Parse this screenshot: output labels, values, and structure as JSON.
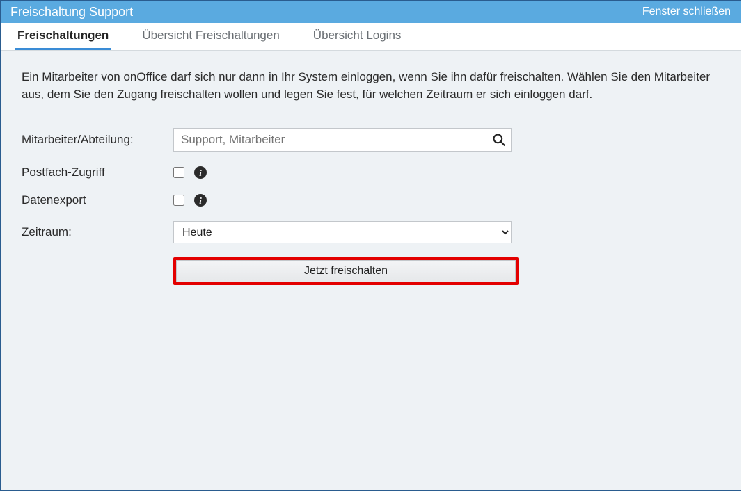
{
  "titlebar": {
    "title": "Freischaltung Support",
    "close_label": "Fenster schließen"
  },
  "tabs": [
    {
      "label": "Freischaltungen",
      "active": true
    },
    {
      "label": "Übersicht Freischaltungen",
      "active": false
    },
    {
      "label": "Übersicht Logins",
      "active": false
    }
  ],
  "intro_text": "Ein Mitarbeiter von onOffice darf sich nur dann in Ihr System einloggen, wenn Sie ihn dafür freischalten. Wählen Sie den Mitarbeiter aus, dem Sie den Zugang freischalten wollen und legen Sie fest, für welchen Zeitraum er sich einloggen darf.",
  "form": {
    "employee": {
      "label": "Mitarbeiter/Abteilung:",
      "placeholder": "Support, Mitarbeiter",
      "value": ""
    },
    "mailbox_access": {
      "label": "Postfach-Zugriff",
      "checked": false
    },
    "data_export": {
      "label": "Datenexport",
      "checked": false
    },
    "period": {
      "label": "Zeitraum:",
      "selected": "Heute"
    },
    "submit_label": "Jetzt freischalten"
  }
}
